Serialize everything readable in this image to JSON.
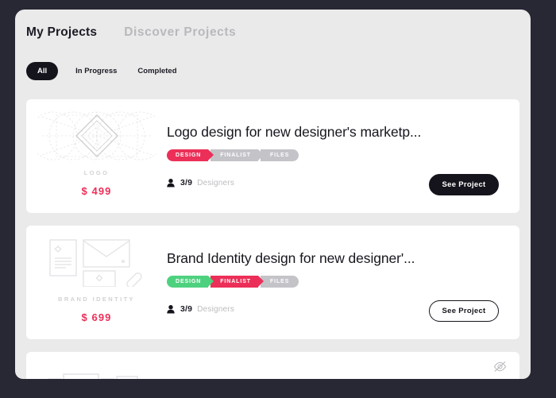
{
  "theme": {
    "page_background": "#282734",
    "panel_background": "#eaeaea",
    "card_background": "#ffffff",
    "accent_pink": "#ec2f58",
    "accent_green": "#4ed17f",
    "step_gray": "#c3c3c8",
    "dark": "#15141c"
  },
  "header": {
    "tabs": [
      {
        "label": "My Projects",
        "active": true
      },
      {
        "label": "Discover Projects",
        "active": false
      }
    ]
  },
  "filters": [
    {
      "label": "All",
      "active": true
    },
    {
      "label": "In Progress",
      "active": false
    },
    {
      "label": "Completed",
      "active": false
    }
  ],
  "cards": [
    {
      "thumb_label": "LOGO",
      "thumb_icon": "logo-grid-diamond-icon",
      "price": "$ 499",
      "title": "Logo design for new designer's marketp...",
      "steps": [
        {
          "label": "DESIGN",
          "state": "pink"
        },
        {
          "label": "FINALIST",
          "state": "gray"
        },
        {
          "label": "FILES",
          "state": "gray"
        }
      ],
      "designers_count": "3/9",
      "designers_label": "Designers",
      "button_label": "See Project",
      "button_style": "filled"
    },
    {
      "thumb_label": "BRAND IDENTITY",
      "thumb_icon": "brand-identity-stationery-icon",
      "price": "$ 699",
      "title": "Brand Identity design for new designer'...",
      "steps": [
        {
          "label": "DESIGN",
          "state": "green"
        },
        {
          "label": "FINALIST",
          "state": "pink"
        },
        {
          "label": "FILES",
          "state": "gray"
        }
      ],
      "designers_count": "3/9",
      "designers_label": "Designers",
      "button_label": "See Project",
      "button_style": "outline"
    },
    {
      "thumb_icon": "packaging-boxes-icon",
      "hide_icon": "eye-slash-icon"
    }
  ]
}
